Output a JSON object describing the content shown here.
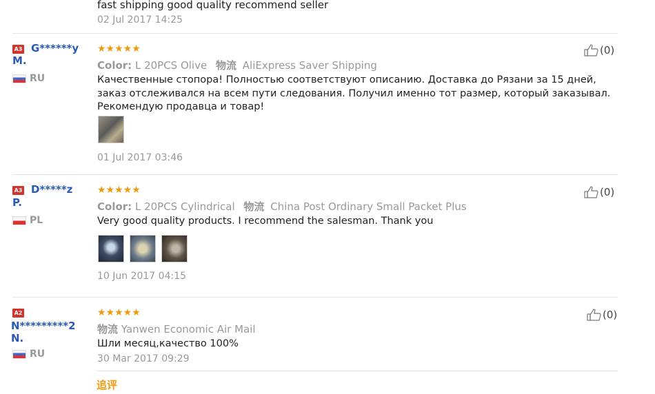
{
  "previous_review": {
    "text": "fast shipping good quality recommend seller",
    "date": "02 Jul 2017 14:25"
  },
  "reviews": [
    {
      "level": "A3",
      "name_line1": "G******y",
      "name_line2": "M.",
      "country": "RU",
      "stars": "★★★★★",
      "color_label": "Color:",
      "color_value": "L 20PCS Olive",
      "shipping_label": "物流",
      "shipping": "AliExpress Saver Shipping",
      "feedback": "Качественные стопора! Полностью соответствуют описанию. Доставка до Рязани за 15 дней, заказ отслеживался на всем пути следования. Получил именно тот размер, который заказывал. Рекомендую продавца и товар!",
      "date": "01 Jul 2017 03:46",
      "helpful": "(0)"
    },
    {
      "level": "A3",
      "name_line1": "D*****z",
      "name_line2": "P.",
      "country": "PL",
      "stars": "★★★★★",
      "color_label": "Color:",
      "color_value": "L 20PCS Cylindrical",
      "shipping_label": "物流",
      "shipping": "China Post Ordinary Small Packet Plus",
      "feedback": "Very good quality products. I recommend the salesman. Thank you",
      "date": "10 Jun 2017 04:15",
      "helpful": "(0)"
    },
    {
      "level": "A2",
      "name_line1": "N*********2",
      "name_line2": "N.",
      "country": "RU",
      "stars": "★★★★★",
      "shipping_label": "物流",
      "shipping": "Yanwen Economic Air Mail",
      "feedback": "Шли месяц,качество 100%",
      "date": "30 Mar 2017 09:29",
      "helpful": "(0)",
      "add_review": "追评"
    }
  ]
}
